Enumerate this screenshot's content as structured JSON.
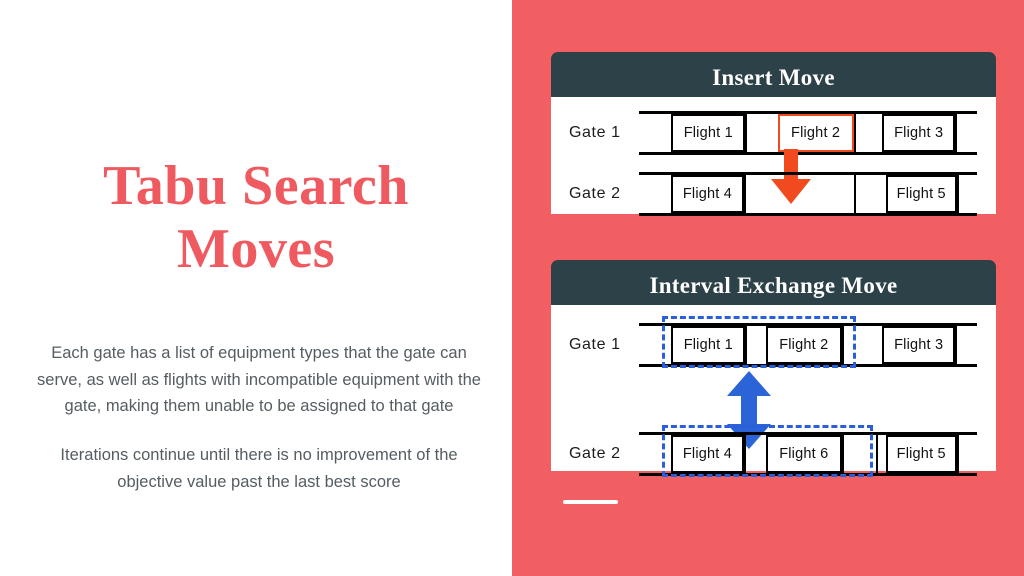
{
  "slide": {
    "title": "Tabu Search Moves",
    "title_color": "#ef5a60",
    "background_color": "#ffffff",
    "accent_panel_color": "#f15f62",
    "header_color": "#2d4148"
  },
  "body_text": {
    "paragraphs": [
      "Each gate has a list of equipment types that the gate can serve, as well as flights with incompatible equipment with the gate, making them unable to be assigned to that gate",
      "Iterations continue until there is no improvement of the objective value past the last best score"
    ]
  },
  "diagrams": [
    {
      "id": "insert-move",
      "title": "Insert Move",
      "gates": [
        {
          "label": "Gate 1",
          "flights": [
            {
              "name": "Flight 1",
              "left_pct": 9.5,
              "width_pct": 22.0,
              "highlight": "none"
            },
            {
              "name": "Flight 2",
              "left_pct": 41.0,
              "width_pct": 22.5,
              "highlight": "orange"
            },
            {
              "name": "Flight 3",
              "left_pct": 72.0,
              "width_pct": 21.5,
              "highlight": "none"
            }
          ],
          "ticks_pct": [
            31.5,
            63.5,
            93.5
          ]
        },
        {
          "label": "Gate 2",
          "flights": [
            {
              "name": "Flight 4",
              "left_pct": 9.5,
              "width_pct": 21.5,
              "highlight": "none"
            },
            {
              "name": "Flight 5",
              "left_pct": 73.0,
              "width_pct": 21.0,
              "highlight": "none"
            }
          ],
          "ticks_pct": [
            31.0,
            63.5,
            94.0
          ]
        }
      ],
      "annotation": {
        "type": "arrow-down",
        "color": "#f04a1e",
        "from": "Flight 2 on Gate 1",
        "to": "Gate 2"
      }
    },
    {
      "id": "interval-exchange-move",
      "title": "Interval Exchange Move",
      "gates": [
        {
          "label": "Gate 1",
          "flights": [
            {
              "name": "Flight 1",
              "left_pct": 9.5,
              "width_pct": 22.0,
              "highlight": "none"
            },
            {
              "name": "Flight 2",
              "left_pct": 37.5,
              "width_pct": 22.5,
              "highlight": "none"
            },
            {
              "name": "Flight 3",
              "left_pct": 72.0,
              "width_pct": 21.5,
              "highlight": "none"
            }
          ],
          "ticks_pct": [
            31.5,
            63.5,
            93.5
          ],
          "selection_pct": {
            "left": 7.0,
            "width": 57.0
          }
        },
        {
          "label": "Gate 2",
          "flights": [
            {
              "name": "Flight 4",
              "left_pct": 9.5,
              "width_pct": 21.5,
              "highlight": "none"
            },
            {
              "name": "Flight 6",
              "left_pct": 37.5,
              "width_pct": 22.5,
              "highlight": "none"
            },
            {
              "name": "Flight 5",
              "left_pct": 73.0,
              "width_pct": 21.0,
              "highlight": "none"
            }
          ],
          "ticks_pct": [
            31.0,
            63.5,
            94.0
          ],
          "selection_pct": {
            "left": 7.0,
            "width": 62.0
          }
        }
      ],
      "annotation": {
        "type": "arrow-double-vertical",
        "color": "#2b5fd9",
        "from": "Gate 1 interval",
        "to": "Gate 2 interval"
      }
    }
  ]
}
